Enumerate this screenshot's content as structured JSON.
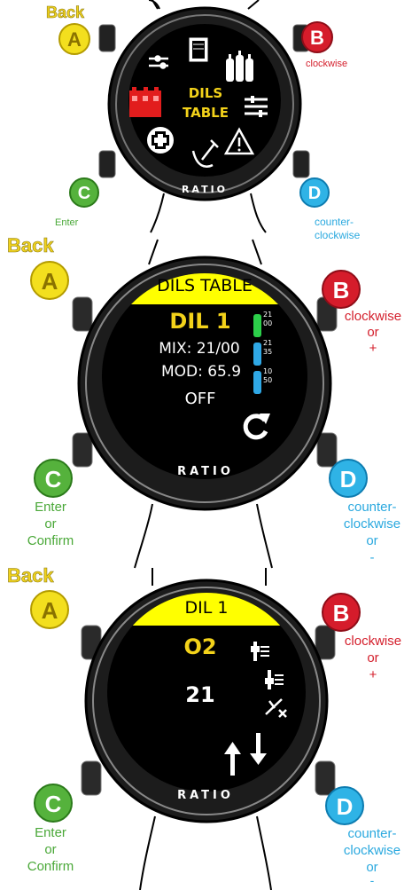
{
  "colors": {
    "yellow": "#f3df1e",
    "red": "#d51c2b",
    "green": "#55b23c",
    "blue": "#2fb3e6",
    "screen_bg": "#000000",
    "header_yellow": "#ffff00",
    "title_yellow": "#f3d21a"
  },
  "buttons": {
    "a": "A",
    "b": "B",
    "c": "C",
    "d": "D"
  },
  "panel1": {
    "back": "Back",
    "b_label": "clockwise",
    "c_label": "Enter",
    "d_label_1": "counter-",
    "d_label_2": "clockwise",
    "screen_title_1": "DILS",
    "screen_title_2": "TABLE",
    "brand": "RATIO",
    "icons": [
      "settings-icon",
      "book-icon",
      "tanks-icon",
      "sliders-icon",
      "warning-icon",
      "dive-icon",
      "first-aid-icon",
      "dils-table-icon"
    ]
  },
  "panel2": {
    "back": "Back",
    "b_label_1": "clockwise",
    "b_label_2": "or",
    "b_label_3": "+",
    "c_label_1": "Enter",
    "c_label_2": "or",
    "c_label_3": "Confirm",
    "d_label_1": "counter-",
    "d_label_2": "clockwise",
    "d_label_3": "or",
    "d_label_4": "-",
    "header": "DILS TABLE",
    "dil_name": "DIL 1",
    "mix": "MIX: 21/00",
    "mod": "MOD: 65.9",
    "status": "OFF",
    "brand": "RATIO",
    "tanks": [
      {
        "color": "#2ccf4a",
        "top": "21",
        "bottom": "00"
      },
      {
        "color": "#2fa8e6",
        "top": "21",
        "bottom": "35"
      },
      {
        "color": "#2fa8e6",
        "top": "10",
        "bottom": "50"
      }
    ]
  },
  "panel3": {
    "back": "Back",
    "b_label_1": "clockwise",
    "b_label_2": "or",
    "b_label_3": "+",
    "c_label_1": "Enter",
    "c_label_2": "or",
    "c_label_3": "Confirm",
    "d_label_1": "counter-",
    "d_label_2": "clockwise",
    "d_label_3": "or",
    "d_label_4": "-",
    "header": "DIL 1",
    "field": "O2",
    "value": "21",
    "brand": "RATIO"
  }
}
